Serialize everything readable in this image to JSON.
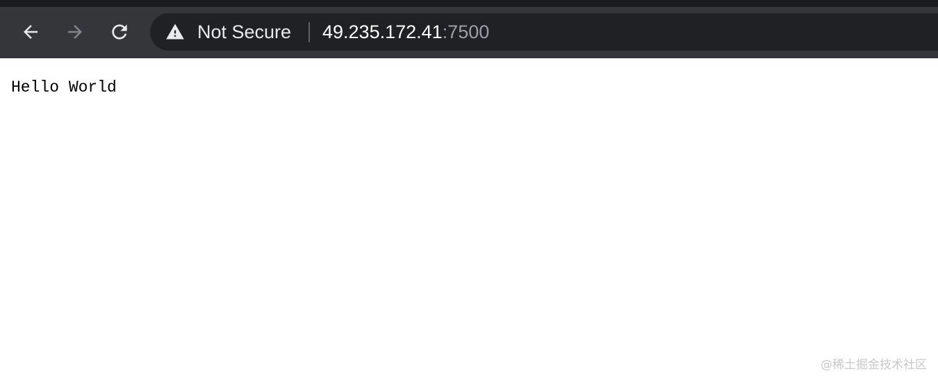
{
  "browser": {
    "nav": {
      "back_icon": "arrow-left-icon",
      "forward_icon": "arrow-right-icon",
      "reload_icon": "reload-icon",
      "forward_enabled": false
    },
    "omnibox": {
      "security_icon": "warning-triangle-icon",
      "security_label": "Not Secure",
      "url_host": "49.235.172.41",
      "url_port": ":7500"
    },
    "colors": {
      "toolbar": "#35363a",
      "omnibox": "#202124",
      "icon_active": "#e8eaed",
      "icon_disabled": "#80868b",
      "url_port": "#9aa0a6"
    }
  },
  "page": {
    "body_text": "Hello World"
  },
  "watermark": {
    "text": "@稀土掘金技术社区"
  }
}
